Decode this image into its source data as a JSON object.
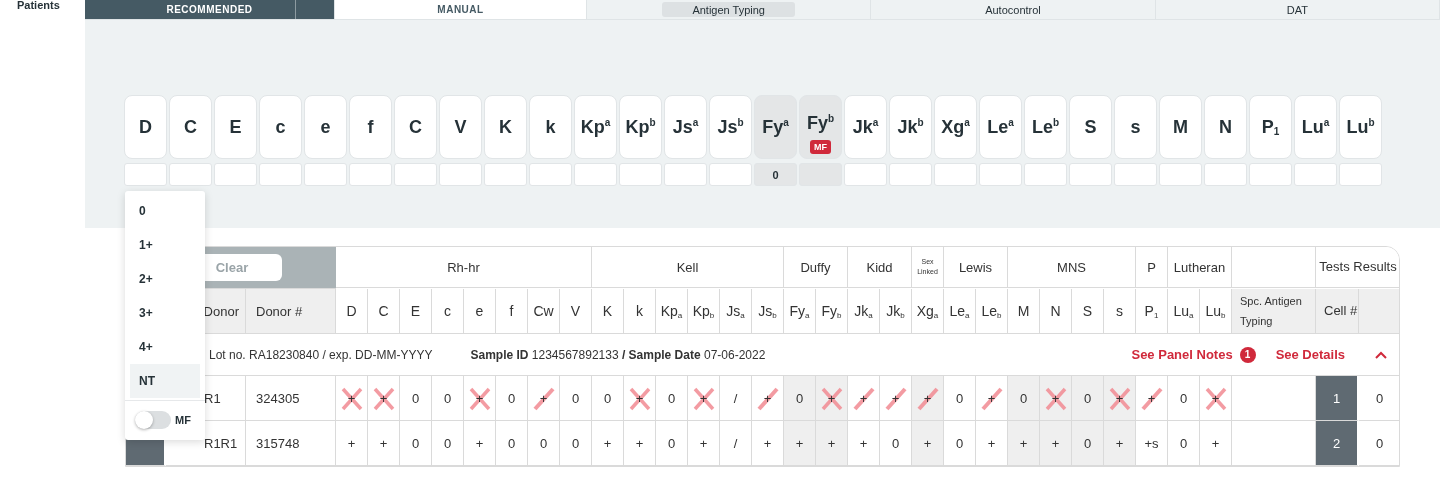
{
  "sidebar": {
    "label": "Patients"
  },
  "mode_tabs": [
    {
      "label": "RECOMMENDED",
      "selected": true
    },
    {
      "label": "MANUAL",
      "selected": false
    }
  ],
  "step_tabs": [
    {
      "label": "Antigen Typing",
      "selected": true
    },
    {
      "label": "Autocontrol",
      "selected": false
    },
    {
      "label": "DAT",
      "selected": false
    }
  ],
  "antigens": [
    {
      "label": "D",
      "selected": false
    },
    {
      "label": "C",
      "selected": false
    },
    {
      "label": "E",
      "selected": false
    },
    {
      "label": "c",
      "selected": false
    },
    {
      "label": "e",
      "selected": false
    },
    {
      "label": "f",
      "selected": false
    },
    {
      "label": "C",
      "selected": false
    },
    {
      "label": "V",
      "selected": false
    },
    {
      "label": "K",
      "selected": false
    },
    {
      "label": "k",
      "selected": false
    },
    {
      "label": "Kp$^{a}$",
      "selected": false
    },
    {
      "label": "Kp$^{b}$",
      "selected": false
    },
    {
      "label": "Js$^{a}$",
      "selected": false
    },
    {
      "label": "Js$^{b}$",
      "selected": false
    },
    {
      "label": "Fy$^{a}$",
      "selected": true,
      "result": "0"
    },
    {
      "label": "Fy$^{b}$",
      "selected": true,
      "badge": "MF"
    },
    {
      "label": "Jk$^{a}$",
      "selected": false
    },
    {
      "label": "Jk$^{b}$",
      "selected": false
    },
    {
      "label": "Xg$^{a}$",
      "selected": false
    },
    {
      "label": "Le$^{a}$",
      "selected": false
    },
    {
      "label": "Le$^{b}$",
      "selected": false
    },
    {
      "label": "S",
      "selected": false
    },
    {
      "label": "s",
      "selected": false
    },
    {
      "label": "M",
      "selected": false
    },
    {
      "label": "N",
      "selected": false
    },
    {
      "label": "P$_{1}$",
      "selected": false
    },
    {
      "label": "Lu$^{a}$",
      "selected": false
    },
    {
      "label": "Lu$^{b}$",
      "selected": false
    }
  ],
  "dropdown": {
    "options": [
      {
        "label": "0",
        "selected": false
      },
      {
        "label": "1+",
        "selected": false
      },
      {
        "label": "2+",
        "selected": false
      },
      {
        "label": "3+",
        "selected": false
      },
      {
        "label": "4+",
        "selected": false
      },
      {
        "label": "NT",
        "selected": true
      }
    ],
    "toggle": {
      "label": "MF",
      "on": false
    }
  },
  "table": {
    "clear_button": "Clear",
    "groups": [
      {
        "label": "Rh-hr",
        "kind": "normal",
        "columns": [
          {
            "label": "D",
            "shaded": false
          },
          {
            "label": "C",
            "shaded": false
          },
          {
            "label": "E",
            "shaded": false
          },
          {
            "label": "c",
            "shaded": false
          },
          {
            "label": "e",
            "shaded": false
          },
          {
            "label": "f",
            "shaded": false
          },
          {
            "label": "Cw",
            "shaded": false
          },
          {
            "label": "V",
            "shaded": false
          }
        ]
      },
      {
        "label": "Kell",
        "kind": "normal",
        "columns": [
          {
            "label": "K",
            "shaded": false
          },
          {
            "label": "k",
            "shaded": false
          },
          {
            "label": "Kp$_{a}$",
            "shaded": false
          },
          {
            "label": "Kp$_{b}$",
            "shaded": false
          },
          {
            "label": "Js$_{a}$",
            "shaded": false
          },
          {
            "label": "Js$_{b}$",
            "shaded": false
          }
        ]
      },
      {
        "label": "Duffy",
        "kind": "normal",
        "columns": [
          {
            "label": "Fy$_{a}$",
            "shaded": true
          },
          {
            "label": "Fy$_{b}$",
            "shaded": true
          }
        ]
      },
      {
        "label": "Kidd",
        "kind": "normal",
        "columns": [
          {
            "label": "Jk$_{a}$",
            "shaded": false
          },
          {
            "label": "Jk$_{b}$",
            "shaded": false
          }
        ]
      },
      {
        "label": "Sex Linked",
        "kind": "small",
        "columns": [
          {
            "label": "Xg$_{a}$",
            "shaded": true
          }
        ]
      },
      {
        "label": "Lewis",
        "kind": "normal",
        "columns": [
          {
            "label": "Le$_{a}$",
            "shaded": false
          },
          {
            "label": "Le$_{b}$",
            "shaded": false
          }
        ]
      },
      {
        "label": "MNS",
        "kind": "normal",
        "columns": [
          {
            "label": "M",
            "shaded": true
          },
          {
            "label": "N",
            "shaded": true
          },
          {
            "label": "S",
            "shaded": true
          },
          {
            "label": "s",
            "shaded": true
          }
        ]
      },
      {
        "label": "P",
        "kind": "normal",
        "columns": [
          {
            "label": "P$_{1}$",
            "shaded": false
          }
        ]
      },
      {
        "label": "Lutheran",
        "kind": "normal",
        "columns": [
          {
            "label": "Lu$_{a}$",
            "shaded": false
          },
          {
            "label": "Lu$_{b}$",
            "shaded": false
          }
        ]
      }
    ],
    "results_heading": "Tests Results",
    "donor_heading": "Donor",
    "donor_no_heading": "Donor #",
    "spc_heading": "Spc. Antigen Typing",
    "cell_heading": "Cell #",
    "info": {
      "lot": "Lot no. RA18230840 / exp. DD-MM-YYYY",
      "sample": "**Sample ID** 1234567892133 **/ Sample Date** 07-06-2022",
      "notes_link": "See Panel Notes",
      "notes_count": "1",
      "details_link": "See Details",
      "expanded": true
    },
    "rows": [
      {
        "donor": "R1",
        "donor_no": "324305",
        "cell_no": "1",
        "result": "0",
        "cells": [
          {
            "value": "+",
            "kind": "cross"
          },
          {
            "value": "+",
            "kind": "cross"
          },
          {
            "value": "0",
            "kind": "plain"
          },
          {
            "value": "0",
            "kind": "plain"
          },
          {
            "value": "+",
            "kind": "cross"
          },
          {
            "value": "0",
            "kind": "plain"
          },
          {
            "value": "+",
            "kind": "strike"
          },
          {
            "value": "0",
            "kind": "plain"
          },
          {
            "value": "0",
            "kind": "plain"
          },
          {
            "value": "+",
            "kind": "cross"
          },
          {
            "value": "0",
            "kind": "plain"
          },
          {
            "value": "+",
            "kind": "cross"
          },
          {
            "value": "/",
            "kind": "plain"
          },
          {
            "value": "+",
            "kind": "strike"
          },
          {
            "value": "0",
            "kind": "plain"
          },
          {
            "value": "+",
            "kind": "cross"
          },
          {
            "value": "+",
            "kind": "strike"
          },
          {
            "value": "+",
            "kind": "strike"
          },
          {
            "value": "+",
            "kind": "strike"
          },
          {
            "value": "0",
            "kind": "plain"
          },
          {
            "value": "+",
            "kind": "strike"
          },
          {
            "value": "0",
            "kind": "plain"
          },
          {
            "value": "+",
            "kind": "cross"
          },
          {
            "value": "0",
            "kind": "plain"
          },
          {
            "value": "+",
            "kind": "cross"
          },
          {
            "value": "+",
            "kind": "strike"
          },
          {
            "value": "0",
            "kind": "plain"
          },
          {
            "value": "+",
            "kind": "cross"
          }
        ]
      },
      {
        "donor": "R1R1",
        "donor_no": "315748",
        "cell_no": "2",
        "result": "0",
        "cells": [
          {
            "value": "+",
            "kind": "plain"
          },
          {
            "value": "+",
            "kind": "plain"
          },
          {
            "value": "0",
            "kind": "plain"
          },
          {
            "value": "0",
            "kind": "plain"
          },
          {
            "value": "+",
            "kind": "plain"
          },
          {
            "value": "0",
            "kind": "plain"
          },
          {
            "value": "0",
            "kind": "plain"
          },
          {
            "value": "0",
            "kind": "plain"
          },
          {
            "value": "+",
            "kind": "plain"
          },
          {
            "value": "+",
            "kind": "plain"
          },
          {
            "value": "0",
            "kind": "plain"
          },
          {
            "value": "+",
            "kind": "plain"
          },
          {
            "value": "/",
            "kind": "plain"
          },
          {
            "value": "+",
            "kind": "plain"
          },
          {
            "value": "+",
            "kind": "plain"
          },
          {
            "value": "+",
            "kind": "plain"
          },
          {
            "value": "+",
            "kind": "plain"
          },
          {
            "value": "0",
            "kind": "plain"
          },
          {
            "value": "+",
            "kind": "plain"
          },
          {
            "value": "0",
            "kind": "plain"
          },
          {
            "value": "+",
            "kind": "plain"
          },
          {
            "value": "+",
            "kind": "plain"
          },
          {
            "value": "+",
            "kind": "plain"
          },
          {
            "value": "0",
            "kind": "plain"
          },
          {
            "value": "+",
            "kind": "plain"
          },
          {
            "value": "+s",
            "kind": "plain"
          },
          {
            "value": "0",
            "kind": "plain"
          },
          {
            "value": "+",
            "kind": "plain"
          }
        ]
      }
    ]
  }
}
